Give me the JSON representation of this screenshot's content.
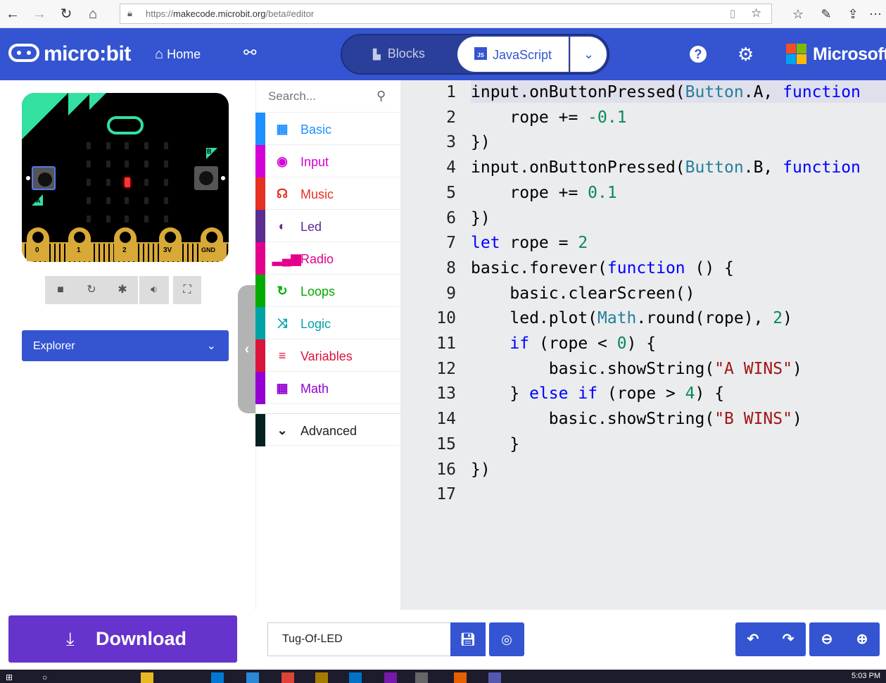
{
  "browser": {
    "url_prefix": "https://",
    "url_host": "makecode.microbit.org",
    "url_path": "/beta#editor"
  },
  "header": {
    "logo_text": "micro:bit",
    "home_label": "Home",
    "blocks_label": "Blocks",
    "javascript_label": "JavaScript",
    "js_badge": "JS",
    "microsoft_label": "Microsoft"
  },
  "simulator": {
    "pin_labels": [
      "0",
      "1",
      "2",
      "3V",
      "GND"
    ],
    "button_a": "A",
    "button_b": "B"
  },
  "explorer": {
    "label": "Explorer"
  },
  "toolbox": {
    "search_placeholder": "Search...",
    "categories": [
      {
        "label": "Basic",
        "color": "#1e90ff"
      },
      {
        "label": "Input",
        "color": "#d400d4"
      },
      {
        "label": "Music",
        "color": "#e63022"
      },
      {
        "label": "Led",
        "color": "#5c2d91"
      },
      {
        "label": "Radio",
        "color": "#e3008c"
      },
      {
        "label": "Loops",
        "color": "#00aa00"
      },
      {
        "label": "Logic",
        "color": "#00a4a6"
      },
      {
        "label": "Variables",
        "color": "#dc143c"
      },
      {
        "label": "Math",
        "color": "#9400d3"
      },
      {
        "label": "Advanced",
        "color": "#042021"
      }
    ]
  },
  "code": {
    "line_numbers": [
      "1",
      "2",
      "3",
      "4",
      "5",
      "6",
      "7",
      "8",
      "9",
      "10",
      "11",
      "12",
      "13",
      "14",
      "15",
      "16",
      "17"
    ],
    "lines": [
      "input.onButtonPressed(Button.A, function",
      "    rope += -0.1",
      "})",
      "input.onButtonPressed(Button.B, function",
      "    rope += 0.1",
      "})",
      "let rope = 2",
      "basic.forever(function () {",
      "    basic.clearScreen()",
      "    led.plot(Math.round(rope), 2)",
      "    if (rope < 0) {",
      "        basic.showString(\"A WINS\")",
      "    } else if (rope > 4) {",
      "        basic.showString(\"B WINS\")",
      "    }",
      "})",
      ""
    ]
  },
  "footer": {
    "download_label": "Download",
    "project_name": "Tug-Of-LED"
  },
  "taskbar": {
    "clock": "5:03 PM"
  },
  "colors": {
    "brand_blue": "#3454d1",
    "download_purple": "#6633cc",
    "editor_bg": "#eaecee"
  }
}
